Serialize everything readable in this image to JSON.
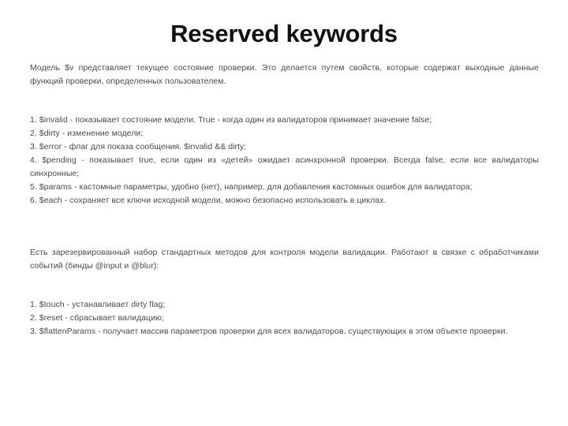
{
  "slide": {
    "title": "Reserved keywords",
    "intro_paragraph": "Модель $v представляет текущее состояние проверки. Это делается путем свойств, которые содержат выходные данные функций проверки, определенных пользователем.",
    "properties_list": [
      "1. $invalid - показывает состояние модели. True - когда один из валидаторов принимает значение false;",
      "2. $dirty - изменение модели;",
      "3. $error - флаг для показа сообщения. $invalid && dirty;",
      "4. $pending - показывает true, если один из «детей» ожидает асинхронной проверки. Всегда false, если все валидаторы синхронные;",
      "5. $params - кастомные параметры, удобно (нет), например, для добавления кастомных ошибок для валидатора;",
      "6. $each - сохраняет все ключи исходной модели, можно безопасно использовать в циклах."
    ],
    "methods_paragraph": "Есть зарезервированный набор стандартных методов для контроля модели валидации. Работают в связке с обработчиками событий (бинды @input и @blur):",
    "methods_list": [
      "1. $touch - устанавливает dirty flag;",
      "2. $reset - сбрасывает валидацию;",
      "3. $flattenParams - получает массив параметров проверки для всех валидаторов, существующих в этом объекте проверки."
    ]
  }
}
